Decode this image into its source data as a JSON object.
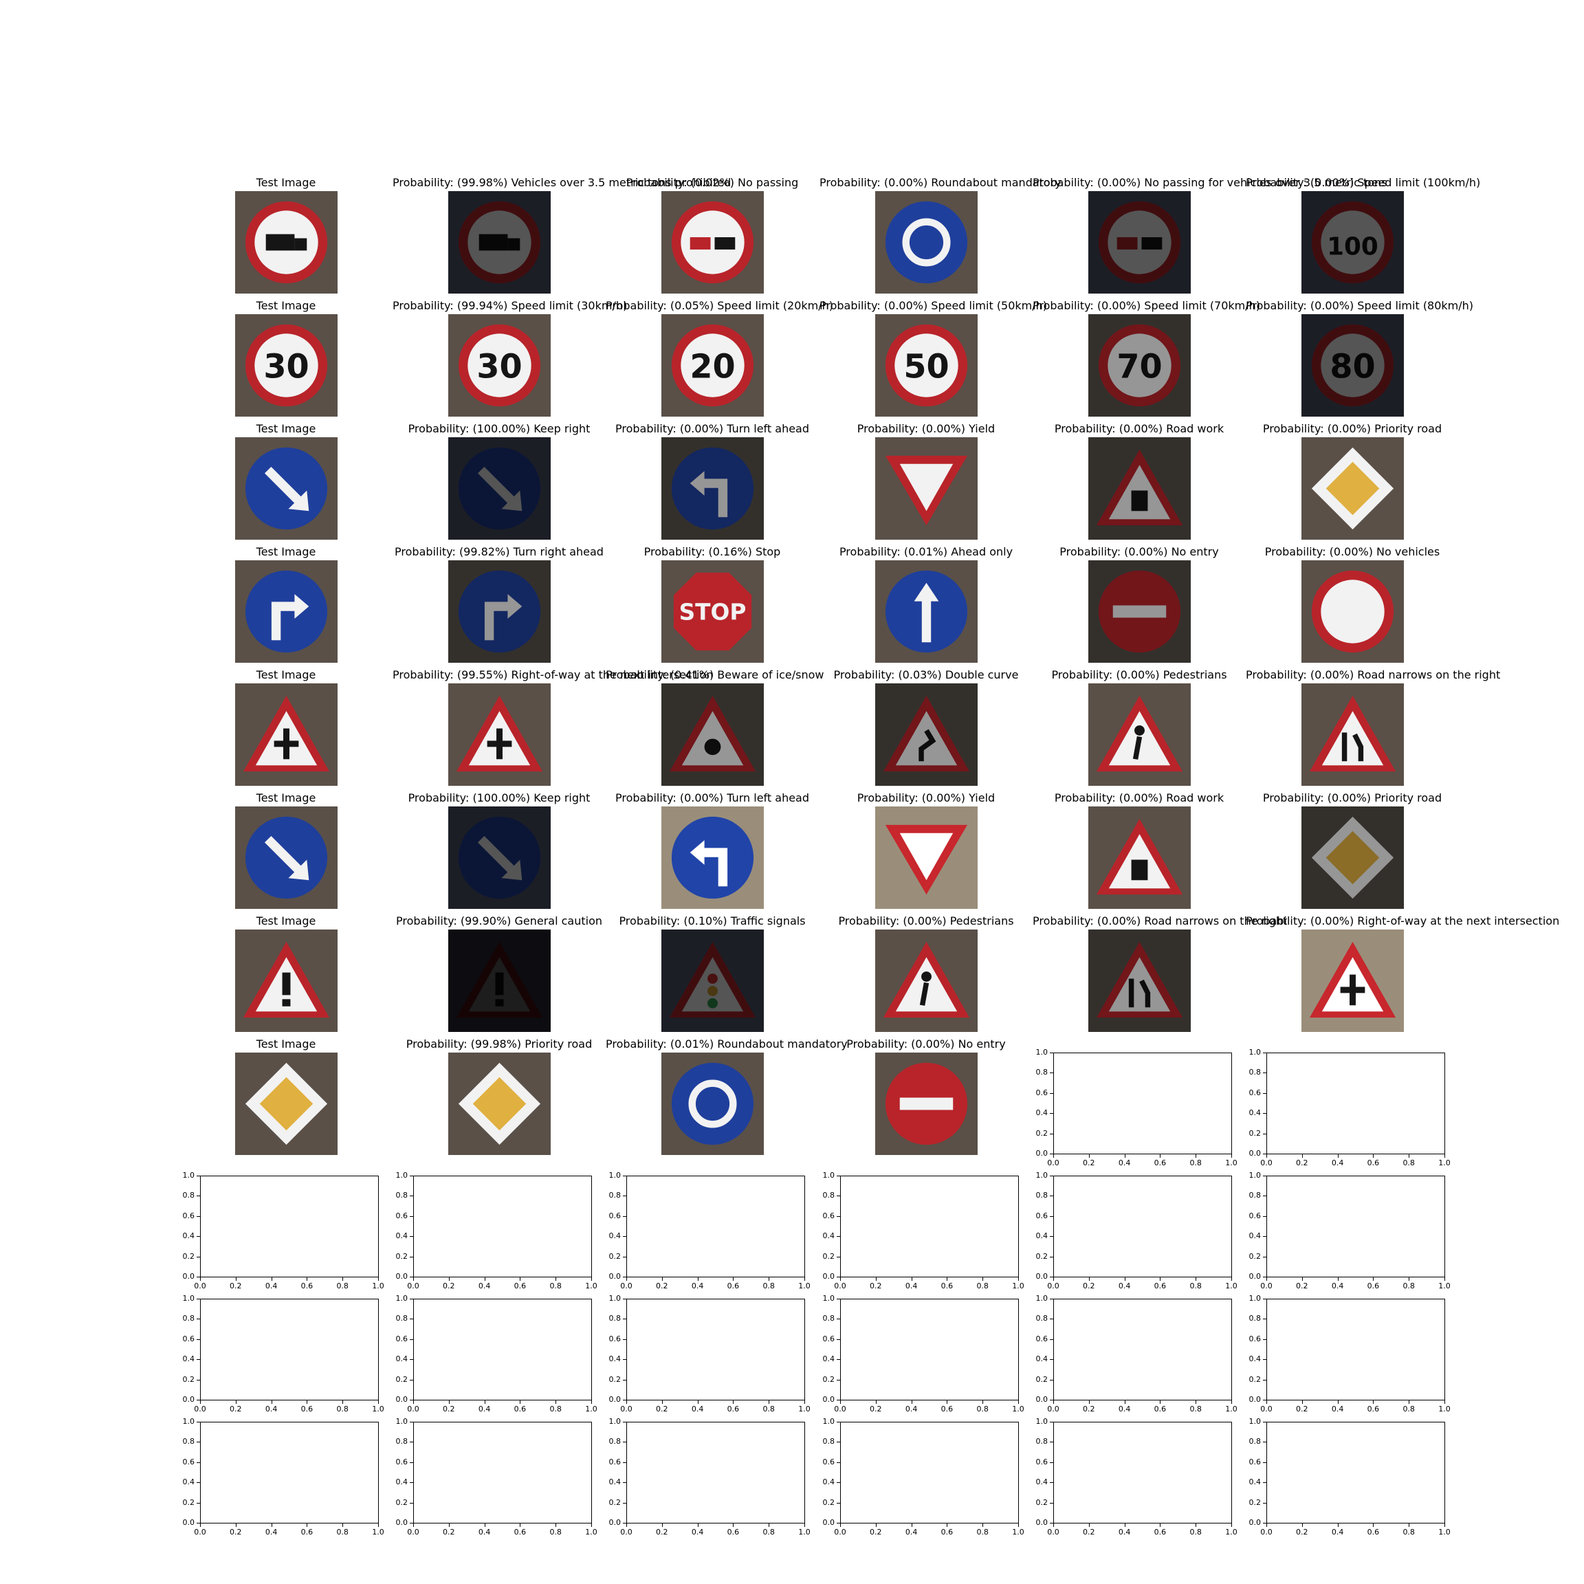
{
  "chart_data": {
    "type": "image_grid",
    "rows": 11,
    "cols": 6,
    "image_rows": [
      {
        "test_label": "Test Image",
        "test_sign": "no-trucks-sign",
        "predictions": [
          {
            "label": "Probability: (99.98%) Vehicles over 3.5 metric tons prohibited",
            "probability": 99.98,
            "class_name": "Vehicles over 3.5 metric tons prohibited",
            "sign": "no-trucks-sign",
            "tone": "dark"
          },
          {
            "label": "Probability: (0.02%) No passing",
            "probability": 0.02,
            "class_name": "No passing",
            "sign": "no-passing-sign",
            "tone": "normal"
          },
          {
            "label": "Probability: (0.00%) Roundabout mandatory",
            "probability": 0.0,
            "class_name": "Roundabout mandatory",
            "sign": "roundabout-sign",
            "tone": "normal"
          },
          {
            "label": "Probability: (0.00%) No passing for vehicles over 3.5 metric tons",
            "probability": 0.0,
            "class_name": "No passing for vehicles over 3.5 metric tons",
            "sign": "no-passing-trucks-sign",
            "tone": "dark"
          },
          {
            "label": "Probability: (0.00%) Speed limit (100km/h)",
            "probability": 0.0,
            "class_name": "Speed limit (100km/h)",
            "sign": "speed-limit-100-sign",
            "tone": "dark"
          }
        ]
      },
      {
        "test_label": "Test Image",
        "test_sign": "speed-limit-30-sign",
        "predictions": [
          {
            "label": "Probability: (99.94%) Speed limit (30km/h)",
            "probability": 99.94,
            "class_name": "Speed limit (30km/h)",
            "sign": "speed-limit-30-sign",
            "tone": "normal"
          },
          {
            "label": "Probability: (0.05%) Speed limit (20km/h)",
            "probability": 0.05,
            "class_name": "Speed limit (20km/h)",
            "sign": "speed-limit-20-sign",
            "tone": "normal"
          },
          {
            "label": "Probability: (0.00%) Speed limit (50km/h)",
            "probability": 0.0,
            "class_name": "Speed limit (50km/h)",
            "sign": "speed-limit-50-sign",
            "tone": "normal"
          },
          {
            "label": "Probability: (0.00%) Speed limit (70km/h)",
            "probability": 0.0,
            "class_name": "Speed limit (70km/h)",
            "sign": "speed-limit-70-sign",
            "tone": "dim"
          },
          {
            "label": "Probability: (0.00%) Speed limit (80km/h)",
            "probability": 0.0,
            "class_name": "Speed limit (80km/h)",
            "sign": "speed-limit-80-sign",
            "tone": "dark"
          }
        ]
      },
      {
        "test_label": "Test Image",
        "test_sign": "keep-right-sign",
        "predictions": [
          {
            "label": "Probability: (100.00%) Keep right",
            "probability": 100.0,
            "class_name": "Keep right",
            "sign": "keep-right-sign",
            "tone": "dark"
          },
          {
            "label": "Probability: (0.00%) Turn left ahead",
            "probability": 0.0,
            "class_name": "Turn left ahead",
            "sign": "turn-left-sign",
            "tone": "dim"
          },
          {
            "label": "Probability: (0.00%) Yield",
            "probability": 0.0,
            "class_name": "Yield",
            "sign": "yield-sign",
            "tone": "normal"
          },
          {
            "label": "Probability: (0.00%) Road work",
            "probability": 0.0,
            "class_name": "Road work",
            "sign": "road-work-sign",
            "tone": "dim"
          },
          {
            "label": "Probability: (0.00%) Priority road",
            "probability": 0.0,
            "class_name": "Priority road",
            "sign": "priority-road-sign",
            "tone": "normal"
          }
        ]
      },
      {
        "test_label": "Test Image",
        "test_sign": "turn-right-sign",
        "predictions": [
          {
            "label": "Probability: (99.82%) Turn right ahead",
            "probability": 99.82,
            "class_name": "Turn right ahead",
            "sign": "turn-right-sign",
            "tone": "dim"
          },
          {
            "label": "Probability: (0.16%) Stop",
            "probability": 0.16,
            "class_name": "Stop",
            "sign": "stop-sign",
            "tone": "normal"
          },
          {
            "label": "Probability: (0.01%) Ahead only",
            "probability": 0.01,
            "class_name": "Ahead only",
            "sign": "ahead-only-sign",
            "tone": "normal"
          },
          {
            "label": "Probability: (0.00%) No entry",
            "probability": 0.0,
            "class_name": "No entry",
            "sign": "no-entry-sign",
            "tone": "dim"
          },
          {
            "label": "Probability: (0.00%) No vehicles",
            "probability": 0.0,
            "class_name": "No vehicles",
            "sign": "no-vehicles-sign",
            "tone": "normal"
          }
        ]
      },
      {
        "test_label": "Test Image",
        "test_sign": "right-of-way-sign",
        "predictions": [
          {
            "label": "Probability: (99.55%) Right-of-way at the next intersection",
            "probability": 99.55,
            "class_name": "Right-of-way at the next intersection",
            "sign": "right-of-way-sign",
            "tone": "normal"
          },
          {
            "label": "Probability: (0.41%) Beware of ice/snow",
            "probability": 0.41,
            "class_name": "Beware of ice/snow",
            "sign": "ice-snow-sign",
            "tone": "dim"
          },
          {
            "label": "Probability: (0.03%) Double curve",
            "probability": 0.03,
            "class_name": "Double curve",
            "sign": "double-curve-sign",
            "tone": "dim"
          },
          {
            "label": "Probability: (0.00%) Pedestrians",
            "probability": 0.0,
            "class_name": "Pedestrians",
            "sign": "pedestrians-sign",
            "tone": "normal"
          },
          {
            "label": "Probability: (0.00%) Road narrows on the right",
            "probability": 0.0,
            "class_name": "Road narrows on the right",
            "sign": "road-narrows-sign",
            "tone": "normal"
          }
        ]
      },
      {
        "test_label": "Test Image",
        "test_sign": "keep-right-sign",
        "predictions": [
          {
            "label": "Probability: (100.00%) Keep right",
            "probability": 100.0,
            "class_name": "Keep right",
            "sign": "keep-right-sign",
            "tone": "dark"
          },
          {
            "label": "Probability: (0.00%) Turn left ahead",
            "probability": 0.0,
            "class_name": "Turn left ahead",
            "sign": "turn-left-sign",
            "tone": "bright"
          },
          {
            "label": "Probability: (0.00%) Yield",
            "probability": 0.0,
            "class_name": "Yield",
            "sign": "yield-sign",
            "tone": "bright"
          },
          {
            "label": "Probability: (0.00%) Road work",
            "probability": 0.0,
            "class_name": "Road work",
            "sign": "road-work-sign",
            "tone": "normal"
          },
          {
            "label": "Probability: (0.00%) Priority road",
            "probability": 0.0,
            "class_name": "Priority road",
            "sign": "priority-road-sign",
            "tone": "dim"
          }
        ]
      },
      {
        "test_label": "Test Image",
        "test_sign": "general-caution-sign",
        "predictions": [
          {
            "label": "Probability: (99.90%) General caution",
            "probability": 99.9,
            "class_name": "General caution",
            "sign": "general-caution-sign",
            "tone": "black"
          },
          {
            "label": "Probability: (0.10%) Traffic signals",
            "probability": 0.1,
            "class_name": "Traffic signals",
            "sign": "traffic-signals-sign",
            "tone": "dark"
          },
          {
            "label": "Probability: (0.00%) Pedestrians",
            "probability": 0.0,
            "class_name": "Pedestrians",
            "sign": "pedestrians-sign",
            "tone": "normal"
          },
          {
            "label": "Probability: (0.00%) Road narrows on the right",
            "probability": 0.0,
            "class_name": "Road narrows on the right",
            "sign": "road-narrows-sign",
            "tone": "dim"
          },
          {
            "label": "Probability: (0.00%) Right-of-way at the next intersection",
            "probability": 0.0,
            "class_name": "Right-of-way at the next intersection",
            "sign": "right-of-way-sign",
            "tone": "bright"
          }
        ]
      },
      {
        "test_label": "Test Image",
        "test_sign": "priority-road-sign",
        "predictions": [
          {
            "label": "Probability: (99.98%) Priority road",
            "probability": 99.98,
            "class_name": "Priority road",
            "sign": "priority-road-sign",
            "tone": "normal"
          },
          {
            "label": "Probability: (0.01%) Roundabout mandatory",
            "probability": 0.01,
            "class_name": "Roundabout mandatory",
            "sign": "roundabout-sign",
            "tone": "normal"
          },
          {
            "label": "Probability: (0.00%) No entry",
            "probability": 0.0,
            "class_name": "No entry",
            "sign": "no-entry-sign",
            "tone": "normal"
          }
        ]
      }
    ],
    "empty_axes": {
      "xlim": [
        0.0,
        1.0
      ],
      "ylim": [
        0.0,
        1.0
      ],
      "xticks": [
        "0.0",
        "0.2",
        "0.4",
        "0.6",
        "0.8",
        "1.0"
      ],
      "yticks": [
        "0.0",
        "0.2",
        "0.4",
        "0.6",
        "0.8",
        "1.0"
      ],
      "count": 14
    },
    "grid": false
  }
}
